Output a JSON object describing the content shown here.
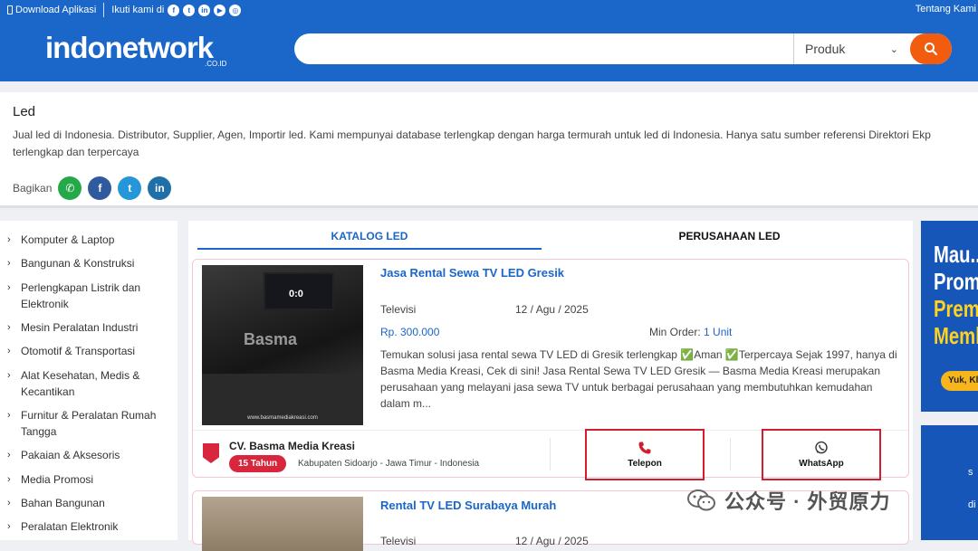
{
  "header": {
    "download_label": "Download Aplikasi",
    "follow_label": "Ikuti kami di",
    "social_icons": [
      "facebook-icon",
      "twitter-icon",
      "linkedin-icon",
      "youtube-icon",
      "instagram-icon"
    ],
    "about_label": "Tentang Kami",
    "logo_text": "indonetwork",
    "logo_sub": ".CO.ID",
    "search_value": "",
    "category_selected": "Produk",
    "brand_color": "#1a66c9",
    "accent_color": "#f25c0f"
  },
  "info": {
    "title": "Led",
    "desc_line1": "Jual led di Indonesia. Distributor, Supplier, Agen, Importir led. Kami mempunyai database terlengkap dengan harga termurah untuk led di Indonesia. Hanya satu sumber referensi Direktori Ekp",
    "desc_line2": "terlengkap dan terpercaya",
    "share_label": "Bagikan"
  },
  "sidebar": {
    "items": [
      {
        "label": "Komputer & Laptop"
      },
      {
        "label": "Bangunan & Konstruksi"
      },
      {
        "label": "Perlengkapan Listrik dan Elektronik"
      },
      {
        "label": "Mesin Peralatan Industri"
      },
      {
        "label": "Otomotif & Transportasi"
      },
      {
        "label": "Alat Kesehatan, Medis & Kecantikan"
      },
      {
        "label": "Furnitur & Peralatan Rumah Tangga"
      },
      {
        "label": "Pakaian & Aksesoris"
      },
      {
        "label": "Media Promosi"
      },
      {
        "label": "Bahan Bangunan"
      },
      {
        "label": "Peralatan Elektronik"
      }
    ]
  },
  "tabs": {
    "catalog": "KATALOG LED",
    "companies": "PERUSAHAAN LED"
  },
  "products": [
    {
      "title": "Jasa Rental Sewa TV LED Gresik",
      "category": "Televisi",
      "date": "12 / Agu / 2025",
      "price": "Rp. 300.000",
      "min_order_label": "Min Order:",
      "min_order_value": "1 Unit",
      "desc": "Temukan solusi jasa rental sewa TV LED di Gresik terlengkap ✅Aman ✅Terpercaya Sejak 1997, hanya di Basma Media Kreasi, Cek di sini! Jasa Rental Sewa TV LED Gresik — Basma Media Kreasi merupakan perusahaan yang melayani jasa sewa TV untuk berbagai perusahaan yang membutuhkan kemudahan dalam m...",
      "image_watermark": "Basma",
      "image_score": "0:0",
      "image_url": "www.basmamediakreasi.com",
      "company": "CV. Basma Media Kreasi",
      "years": "15 Tahun",
      "location": "Kabupaten Sidoarjo - Jawa Timur - Indonesia",
      "call_label": "Telepon",
      "whatsapp_label": "WhatsApp"
    },
    {
      "title": "Rental TV LED Surabaya Murah",
      "category": "Televisi",
      "date": "12 / Agu / 2025"
    }
  ],
  "ads": {
    "ad1_line1": "Mau...",
    "ad1_line2": "Promo",
    "ad1_line3": "Premi",
    "ad1_line4": "Memb",
    "ad1_button": "Yuk, Kl"
  },
  "watermark": {
    "text": "公众号 · 外贸原力"
  }
}
